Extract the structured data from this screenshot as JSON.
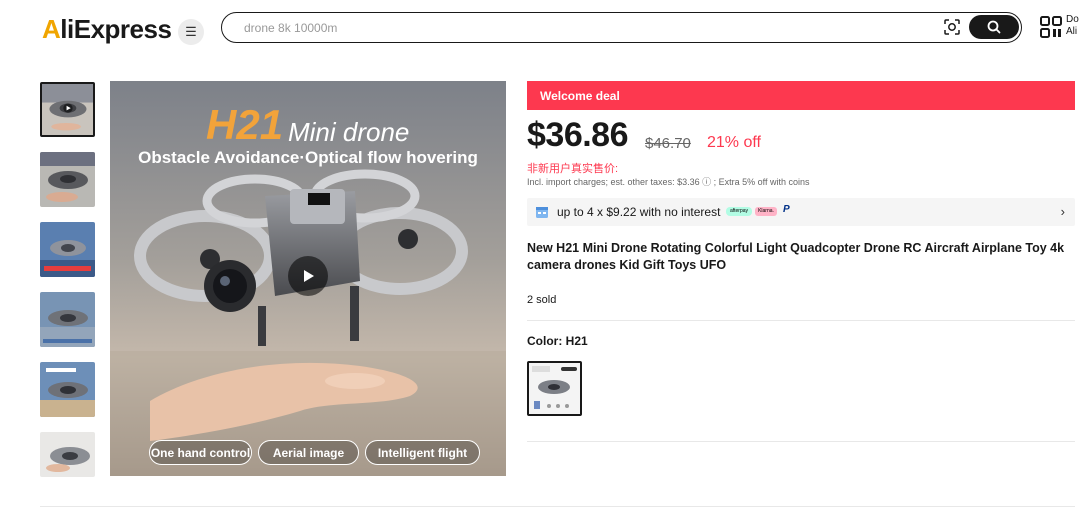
{
  "header": {
    "logo_prefix": "A",
    "logo_rest": "liExpress",
    "search_value": "",
    "search_placeholder": "drone 8k 10000m",
    "download_line1": "Do",
    "download_line2": "Ali"
  },
  "gallery": {
    "thumbnails": [
      "thumb-1",
      "thumb-2",
      "thumb-3",
      "thumb-4",
      "thumb-5",
      "thumb-6"
    ],
    "main_title_h21": "H21",
    "main_title_mini": "Mini drone",
    "main_subtitle": "Obstacle Avoidance·Optical flow hovering",
    "pills": [
      "One hand control",
      "Aerial image",
      "Intelligent flight"
    ]
  },
  "deal": {
    "banner": "Welcome deal",
    "price": "$36.86",
    "original_price": "$46.70",
    "discount": "21% off",
    "cn_label": "非新用户真实售价:",
    "tax_line": "Incl. import charges; est. other taxes: $3.36 ⓘ ; Extra 5% off with coins",
    "installment": "up to 4 x $9.22 with no interest",
    "afterpay_label": "afterpay",
    "klarna_label": "Klarna.",
    "paypal_label": "P"
  },
  "product": {
    "title": "New H21 Mini Drone Rotating Colorful Light Quadcopter Drone RC Aircraft Airplane Toy 4k camera drones Kid Gift Toys UFO",
    "sold": "2 sold",
    "color_label": "Color: H21"
  },
  "colors": {
    "accent_red": "#fd384f",
    "brand_orange": "#f0a500",
    "dark": "#191919"
  }
}
